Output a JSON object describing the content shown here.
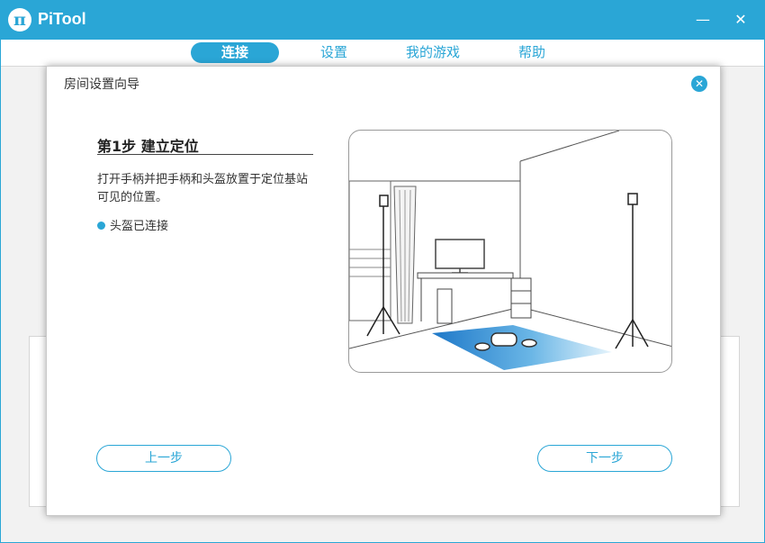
{
  "app": {
    "title": "PiTool",
    "logo_glyph": "π",
    "minimize_glyph": "—",
    "close_glyph": "✕"
  },
  "nav": {
    "tabs": [
      {
        "label": "连接",
        "active": true
      },
      {
        "label": "设置",
        "active": false
      },
      {
        "label": "我的游戏",
        "active": false
      },
      {
        "label": "帮助",
        "active": false
      }
    ]
  },
  "dialog": {
    "title": "房间设置向导",
    "close_glyph": "✕",
    "step_title": "第1步 建立定位",
    "description": "打开手柄并把手柄和头盔放置于定位基站可见的位置。",
    "status": "头盔已连接",
    "prev_label": "上一步",
    "next_label": "下一步"
  },
  "colors": {
    "accent": "#2aa6d6",
    "status_dot": "#2aa6d6",
    "text": "#333333"
  },
  "icons": {
    "logo": "pi-logo-icon",
    "minimize": "minimize-icon",
    "close": "close-icon",
    "dialog_close": "close-circle-icon"
  }
}
